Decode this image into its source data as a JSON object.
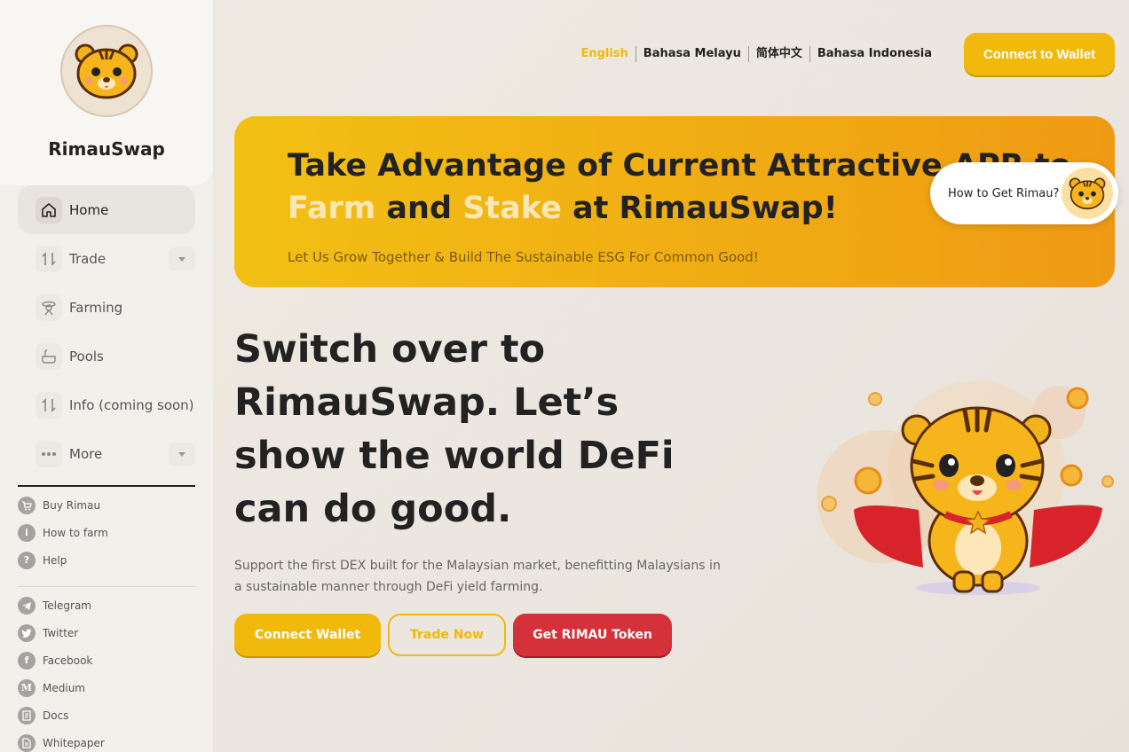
{
  "brand": {
    "name": "RimauSwap",
    "logo_icon": "tiger-logo-icon"
  },
  "sidebar": {
    "nav": [
      {
        "label": "Home",
        "icon": "home-icon",
        "active": true,
        "has_caret": false
      },
      {
        "label": "Trade",
        "icon": "trade-icon",
        "active": false,
        "has_caret": true
      },
      {
        "label": "Farming",
        "icon": "farming-icon",
        "active": false,
        "has_caret": false
      },
      {
        "label": "Pools",
        "icon": "pools-icon",
        "active": false,
        "has_caret": false
      },
      {
        "label": "Info (coming soon)",
        "icon": "info-icon",
        "active": false,
        "has_caret": false
      },
      {
        "label": "More",
        "icon": "more-icon",
        "active": false,
        "has_caret": true
      }
    ],
    "help_links": [
      {
        "label": "Buy Rimau",
        "icon": "cart-icon"
      },
      {
        "label": "How to farm",
        "icon": "info-circle-icon"
      },
      {
        "label": "Help",
        "icon": "question-icon"
      }
    ],
    "social_links": [
      {
        "label": "Telegram",
        "icon": "telegram-icon"
      },
      {
        "label": "Twitter",
        "icon": "twitter-icon"
      },
      {
        "label": "Facebook",
        "icon": "facebook-icon"
      },
      {
        "label": "Medium",
        "icon": "medium-icon"
      },
      {
        "label": "Docs",
        "icon": "docs-icon"
      },
      {
        "label": "Whitepaper",
        "icon": "whitepaper-icon"
      }
    ]
  },
  "header": {
    "languages": [
      "English",
      "Bahasa Melayu",
      "简体中文",
      "Bahasa Indonesia"
    ],
    "selected_language": "English",
    "connect_label": "Connect to Wallet"
  },
  "banner": {
    "title_line1": "Take Advantage of Current Attractive APR to",
    "title_farm": "Farm",
    "title_and": "and",
    "title_stake": "Stake",
    "title_end": "at RimauSwap!",
    "subtitle": "Let Us Grow Together & Build The Sustainable ESG For Common Good!",
    "how_to_label": "How to Get Rimau?"
  },
  "hero": {
    "title": "Switch over to RimauSwap. Let’s show the world DeFi can do good.",
    "description": "Support the first DEX built for the Malaysian market, benefitting Malaysians in a sustainable manner through DeFi yield farming.",
    "buttons": {
      "connect": "Connect Wallet",
      "trade": "Trade Now",
      "token": "Get RIMAU Token"
    }
  },
  "colors": {
    "accent": "#f0b90b",
    "danger": "#d5313a",
    "text": "#222222"
  }
}
